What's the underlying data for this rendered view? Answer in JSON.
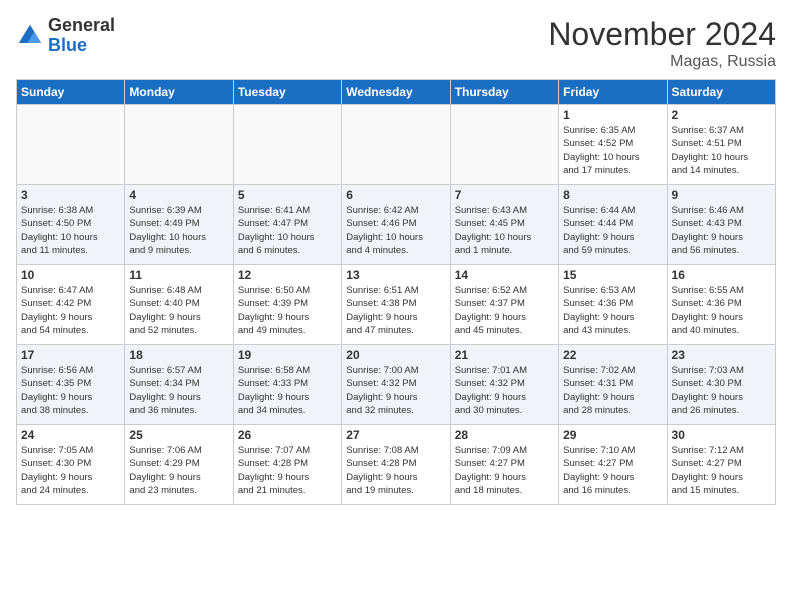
{
  "logo": {
    "general": "General",
    "blue": "Blue"
  },
  "title": "November 2024",
  "location": "Magas, Russia",
  "days_of_week": [
    "Sunday",
    "Monday",
    "Tuesday",
    "Wednesday",
    "Thursday",
    "Friday",
    "Saturday"
  ],
  "weeks": [
    [
      {
        "day": "",
        "info": ""
      },
      {
        "day": "",
        "info": ""
      },
      {
        "day": "",
        "info": ""
      },
      {
        "day": "",
        "info": ""
      },
      {
        "day": "",
        "info": ""
      },
      {
        "day": "1",
        "info": "Sunrise: 6:35 AM\nSunset: 4:52 PM\nDaylight: 10 hours\nand 17 minutes."
      },
      {
        "day": "2",
        "info": "Sunrise: 6:37 AM\nSunset: 4:51 PM\nDaylight: 10 hours\nand 14 minutes."
      }
    ],
    [
      {
        "day": "3",
        "info": "Sunrise: 6:38 AM\nSunset: 4:50 PM\nDaylight: 10 hours\nand 11 minutes."
      },
      {
        "day": "4",
        "info": "Sunrise: 6:39 AM\nSunset: 4:49 PM\nDaylight: 10 hours\nand 9 minutes."
      },
      {
        "day": "5",
        "info": "Sunrise: 6:41 AM\nSunset: 4:47 PM\nDaylight: 10 hours\nand 6 minutes."
      },
      {
        "day": "6",
        "info": "Sunrise: 6:42 AM\nSunset: 4:46 PM\nDaylight: 10 hours\nand 4 minutes."
      },
      {
        "day": "7",
        "info": "Sunrise: 6:43 AM\nSunset: 4:45 PM\nDaylight: 10 hours\nand 1 minute."
      },
      {
        "day": "8",
        "info": "Sunrise: 6:44 AM\nSunset: 4:44 PM\nDaylight: 9 hours\nand 59 minutes."
      },
      {
        "day": "9",
        "info": "Sunrise: 6:46 AM\nSunset: 4:43 PM\nDaylight: 9 hours\nand 56 minutes."
      }
    ],
    [
      {
        "day": "10",
        "info": "Sunrise: 6:47 AM\nSunset: 4:42 PM\nDaylight: 9 hours\nand 54 minutes."
      },
      {
        "day": "11",
        "info": "Sunrise: 6:48 AM\nSunset: 4:40 PM\nDaylight: 9 hours\nand 52 minutes."
      },
      {
        "day": "12",
        "info": "Sunrise: 6:50 AM\nSunset: 4:39 PM\nDaylight: 9 hours\nand 49 minutes."
      },
      {
        "day": "13",
        "info": "Sunrise: 6:51 AM\nSunset: 4:38 PM\nDaylight: 9 hours\nand 47 minutes."
      },
      {
        "day": "14",
        "info": "Sunrise: 6:52 AM\nSunset: 4:37 PM\nDaylight: 9 hours\nand 45 minutes."
      },
      {
        "day": "15",
        "info": "Sunrise: 6:53 AM\nSunset: 4:36 PM\nDaylight: 9 hours\nand 43 minutes."
      },
      {
        "day": "16",
        "info": "Sunrise: 6:55 AM\nSunset: 4:36 PM\nDaylight: 9 hours\nand 40 minutes."
      }
    ],
    [
      {
        "day": "17",
        "info": "Sunrise: 6:56 AM\nSunset: 4:35 PM\nDaylight: 9 hours\nand 38 minutes."
      },
      {
        "day": "18",
        "info": "Sunrise: 6:57 AM\nSunset: 4:34 PM\nDaylight: 9 hours\nand 36 minutes."
      },
      {
        "day": "19",
        "info": "Sunrise: 6:58 AM\nSunset: 4:33 PM\nDaylight: 9 hours\nand 34 minutes."
      },
      {
        "day": "20",
        "info": "Sunrise: 7:00 AM\nSunset: 4:32 PM\nDaylight: 9 hours\nand 32 minutes."
      },
      {
        "day": "21",
        "info": "Sunrise: 7:01 AM\nSunset: 4:32 PM\nDaylight: 9 hours\nand 30 minutes."
      },
      {
        "day": "22",
        "info": "Sunrise: 7:02 AM\nSunset: 4:31 PM\nDaylight: 9 hours\nand 28 minutes."
      },
      {
        "day": "23",
        "info": "Sunrise: 7:03 AM\nSunset: 4:30 PM\nDaylight: 9 hours\nand 26 minutes."
      }
    ],
    [
      {
        "day": "24",
        "info": "Sunrise: 7:05 AM\nSunset: 4:30 PM\nDaylight: 9 hours\nand 24 minutes."
      },
      {
        "day": "25",
        "info": "Sunrise: 7:06 AM\nSunset: 4:29 PM\nDaylight: 9 hours\nand 23 minutes."
      },
      {
        "day": "26",
        "info": "Sunrise: 7:07 AM\nSunset: 4:28 PM\nDaylight: 9 hours\nand 21 minutes."
      },
      {
        "day": "27",
        "info": "Sunrise: 7:08 AM\nSunset: 4:28 PM\nDaylight: 9 hours\nand 19 minutes."
      },
      {
        "day": "28",
        "info": "Sunrise: 7:09 AM\nSunset: 4:27 PM\nDaylight: 9 hours\nand 18 minutes."
      },
      {
        "day": "29",
        "info": "Sunrise: 7:10 AM\nSunset: 4:27 PM\nDaylight: 9 hours\nand 16 minutes."
      },
      {
        "day": "30",
        "info": "Sunrise: 7:12 AM\nSunset: 4:27 PM\nDaylight: 9 hours\nand 15 minutes."
      }
    ]
  ]
}
